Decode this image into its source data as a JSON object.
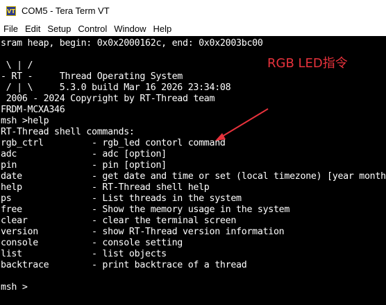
{
  "window": {
    "title": "COM5 - Tera Term VT",
    "app_icon_text": "VT",
    "app_icon_name": "teraterm-vt-icon"
  },
  "menu": {
    "items": [
      "File",
      "Edit",
      "Setup",
      "Control",
      "Window",
      "Help"
    ]
  },
  "terminal": {
    "lines": [
      "sram heap, begin: 0x0x2000162c, end: 0x0x2003bc00",
      "",
      " \\ | /",
      "- RT -     Thread Operating System",
      " / | \\     5.3.0 build Mar 16 2026 23:34:08",
      " 2006 - 2024 Copyright by RT-Thread team",
      "FRDM-MCXA346",
      "msh >help",
      "RT-Thread shell commands:",
      "rgb_ctrl         - rgb_led contorl command",
      "adc              - adc [option]",
      "pin              - pin [option]",
      "date             - get date and time or set (local timezone) [year month day hour min sec]",
      "help             - RT-Thread shell help",
      "ps               - List threads in the system",
      "free             - Show the memory usage in the system",
      "clear            - clear the terminal screen",
      "version          - show RT-Thread version information",
      "console          - console setting",
      "list             - list objects",
      "backtrace        - print backtrace of a thread",
      "",
      "msh >"
    ]
  },
  "annotation": {
    "label": "RGB LED指令",
    "color": "#e8323c"
  },
  "colors": {
    "terminal_bg": "#000000",
    "terminal_fg": "#ffffff",
    "chrome_bg": "#ffffff"
  }
}
